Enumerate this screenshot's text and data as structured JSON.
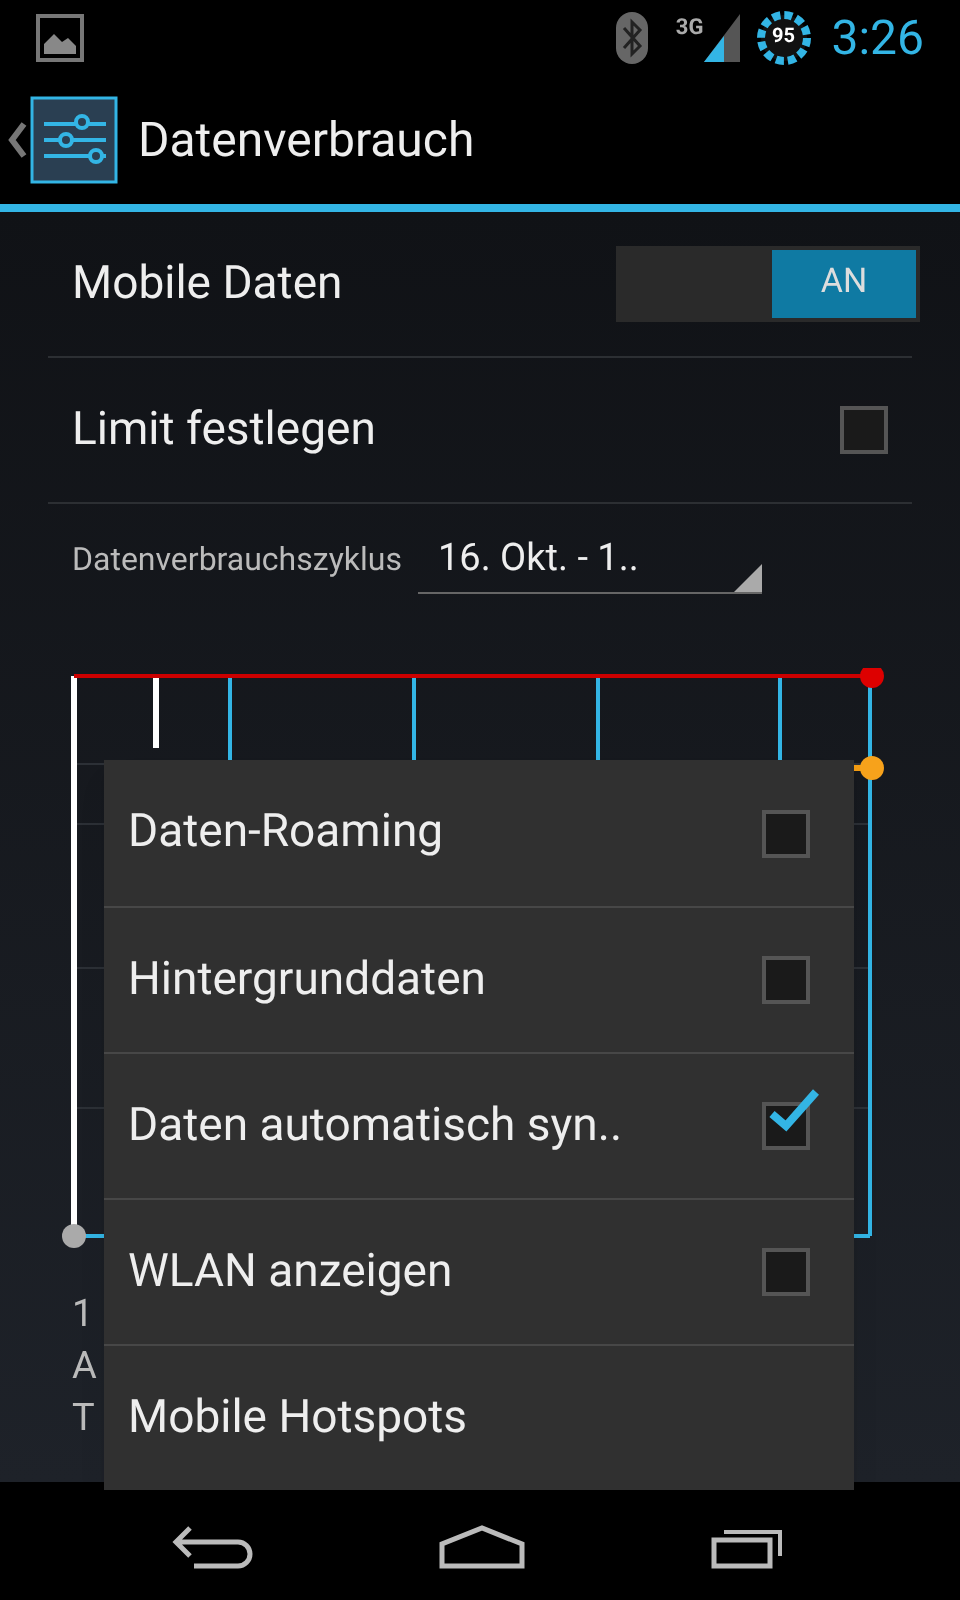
{
  "status_bar": {
    "battery": "95",
    "time": "3:26",
    "network": "3G"
  },
  "action_bar": {
    "title": "Datenverbrauch"
  },
  "settings": [
    {
      "kind": "switch",
      "label": "Mobile Daten",
      "on": true,
      "state_label": "AN"
    },
    {
      "kind": "checkbox",
      "label": "Limit festlegen",
      "checked": false
    }
  ],
  "cycle": {
    "label": "Datenverbrauchszyklus",
    "value": "16. Okt. - 1.."
  },
  "partial_texts": [
    "1",
    "A",
    "T"
  ],
  "menu": [
    {
      "label": "Daten-Roaming",
      "checked": false
    },
    {
      "label": "Hintergrunddaten",
      "checked": false
    },
    {
      "label": "Daten automatisch syn..",
      "checked": true
    },
    {
      "label": "WLAN anzeigen",
      "checked": false
    },
    {
      "label": "Mobile Hotspots"
    }
  ]
}
